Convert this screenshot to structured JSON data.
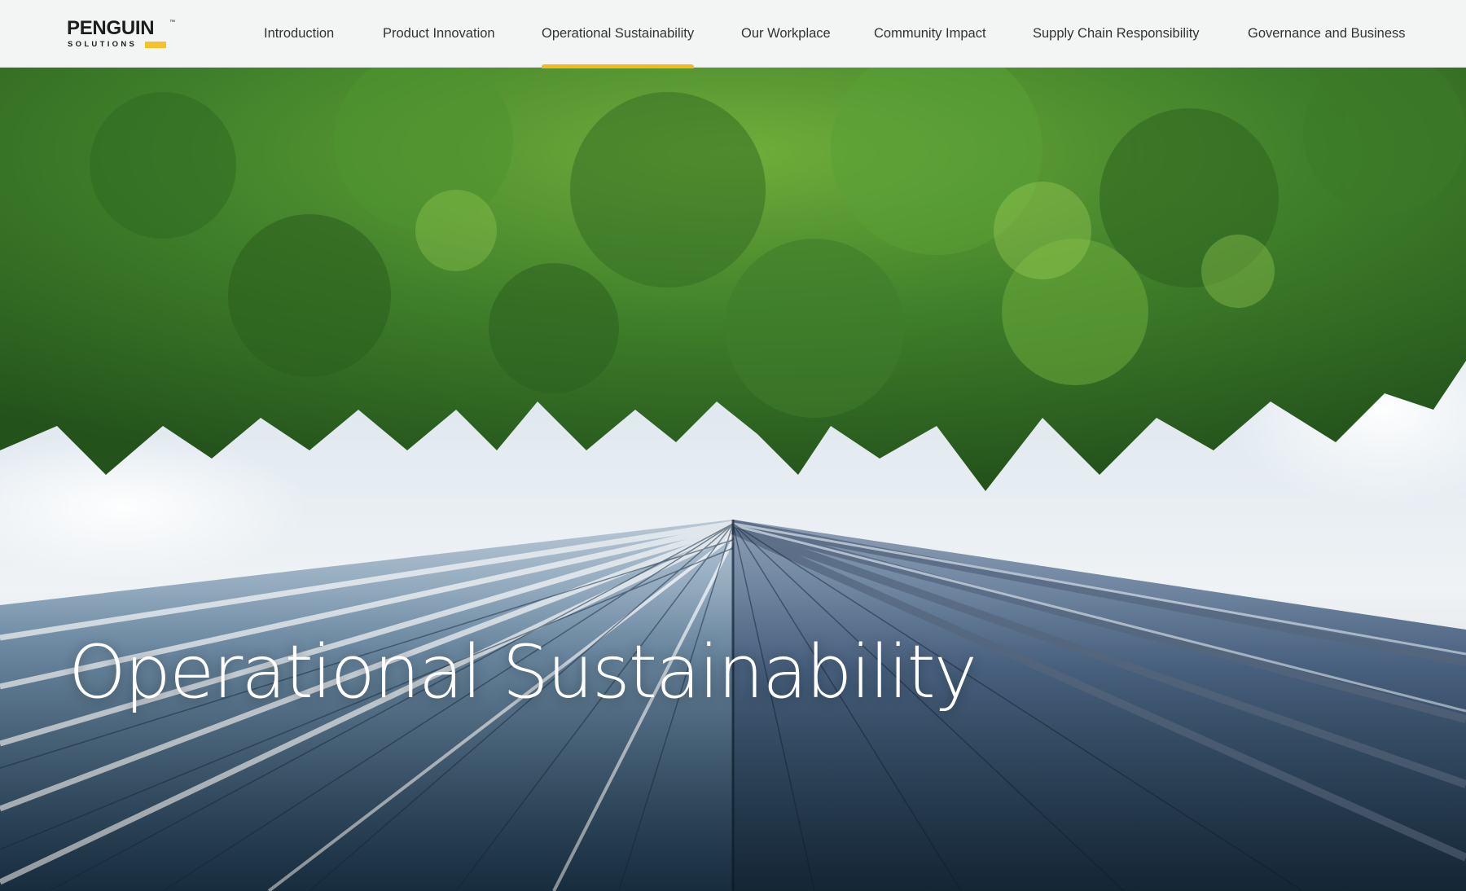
{
  "brand": {
    "name": "PENGUIN",
    "tagline": "SOLUTIONS",
    "accent_color": "#f5c22b"
  },
  "nav": {
    "items": [
      {
        "label": "Introduction",
        "active": false
      },
      {
        "label": "Product Innovation",
        "active": false
      },
      {
        "label": "Operational Sustainability",
        "active": true
      },
      {
        "label": "Our Workplace",
        "active": false
      },
      {
        "label": "Community Impact",
        "active": false
      },
      {
        "label": "Supply Chain Responsibility",
        "active": false
      },
      {
        "label": "Governance and Business",
        "active": false
      }
    ],
    "active_indicator_color": "#f5b91e"
  },
  "hero": {
    "title": "Operational Sustainability",
    "image_subject": "tree-canopy-over-glass-skyscraper"
  }
}
